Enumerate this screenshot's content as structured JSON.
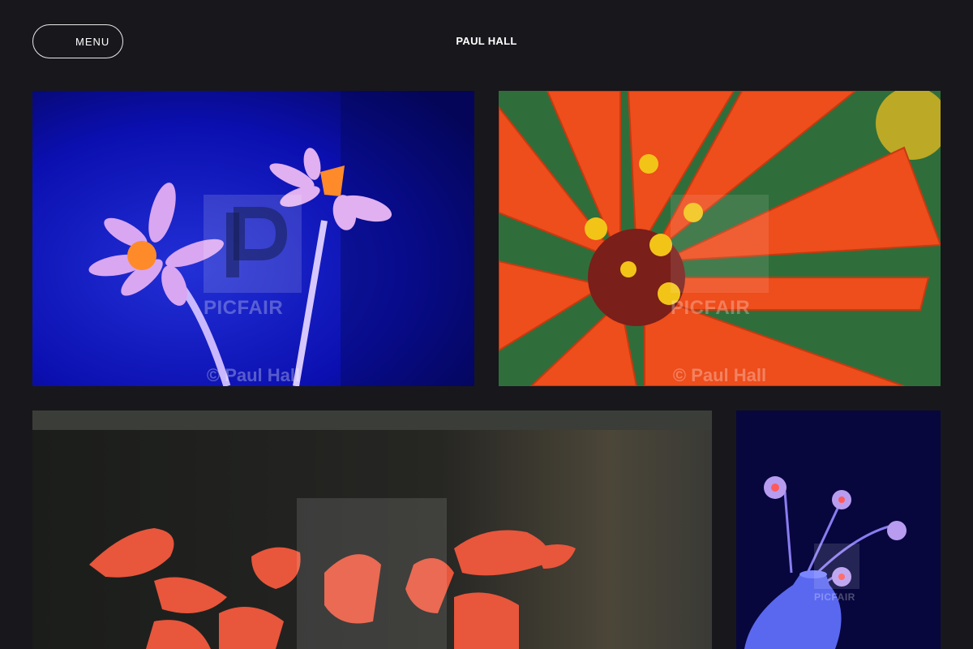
{
  "header": {
    "menu_label": "MENU",
    "site_title": "PAUL HALL"
  },
  "gallery": {
    "photos": [
      {
        "subject": "UV daffodils on blue",
        "watermark": "PICFAIR",
        "credit": "© Paul Hall"
      },
      {
        "subject": "orange zinnia close-up",
        "watermark": "PICFAIR",
        "credit": "© Paul Hall"
      },
      {
        "subject": "red flowers on dark print",
        "watermark": ""
      },
      {
        "subject": "UV flowers in vase",
        "watermark": "PICFAIR"
      }
    ]
  },
  "colors": {
    "background": "#18171c",
    "text": "#ffffff",
    "menu_border": "#e8e8e8"
  },
  "icons": [
    "picfair-logo-icon"
  ]
}
